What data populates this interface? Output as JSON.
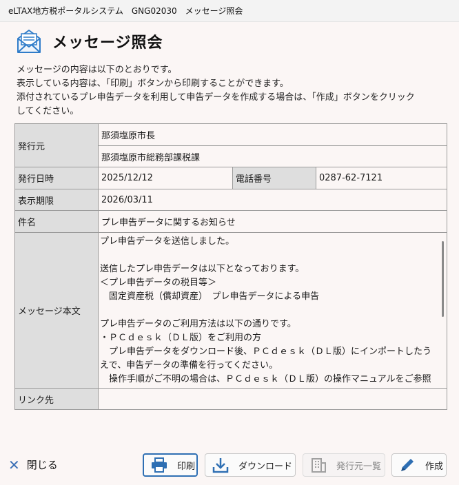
{
  "window": {
    "title": "eLTAX地方税ポータルシステム　GNG02030　メッセージ照会"
  },
  "page": {
    "title": "メッセージ照会",
    "intro": [
      "メッセージの内容は以下のとおりです。",
      "表示している内容は、「印刷」ボタンから印刷することができます。",
      "添付されているプレ申告データを利用して申告データを作成する場合は、「作成」ボタンをクリック",
      "してください。"
    ]
  },
  "detail": {
    "issuer_label": "発行元",
    "issuer_line1": "那須塩原市長",
    "issuer_line2": "那須塩原市総務部課税課",
    "date_label": "発行日時",
    "date_value": "2025/12/12",
    "phone_label": "電話番号",
    "phone_value": "0287-62-7121",
    "expiry_label": "表示期限",
    "expiry_value": "2026/03/11",
    "subject_label": "件名",
    "subject_value": "プレ申告データに関するお知らせ",
    "body_label": "メッセージ本文",
    "body_text": "プレ申告データを送信しました。\n\n送信したプレ申告データは以下となっております。\n＜プレ申告データの税目等＞\n　固定資産税（償却資産）　プレ申告データによる申告\n\nプレ申告データのご利用方法は以下の通りです。\n・ＰＣｄｅｓｋ（ＤＬ版）をご利用の方\n　プレ申告データをダウンロード後、ＰＣｄｅｓｋ（ＤＬ版）にインポートしたうえで、申告データの準備を行ってください。\n　操作手順がご不明の場合は、ＰＣｄｅｓｋ（ＤＬ版）の操作マニュアルをご参照",
    "link_label": "リンク先",
    "link_value": ""
  },
  "footer": {
    "close_label": "閉じる",
    "print_label": "印刷",
    "download_label": "ダウンロード",
    "issuer_list_label": "発行元一覧",
    "create_label": "作成"
  },
  "colors": {
    "accent": "#2e6fb3",
    "label_bg": "#dedede",
    "page_bg": "#fbf6f5"
  }
}
